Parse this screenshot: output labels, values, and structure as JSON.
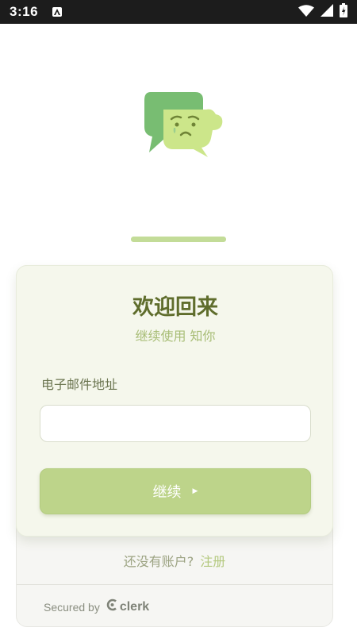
{
  "status_bar": {
    "time": "3:16",
    "icons": [
      "notification-a-icon",
      "wifi-icon",
      "signal-icon",
      "battery-icon"
    ]
  },
  "logo": {
    "icon": "sad-chat-bubble-logo",
    "colors": [
      "#78bd72",
      "#cce68a",
      "#7a8f3a"
    ]
  },
  "progress": {
    "value": 1.0,
    "color": "#c3dc98"
  },
  "sign_in": {
    "title": "欢迎回来",
    "subtitle": "继续使用 知你",
    "email_label": "电子邮件地址",
    "email_value": "",
    "continue_label": "继续",
    "continue_icon": "play-arrow-icon"
  },
  "footer": {
    "no_account_text": "还没有账户?",
    "signup_link": "注册",
    "secured_by": "Secured by",
    "clerk_brand": "clerk"
  },
  "colors": {
    "accent": "#bdd48a",
    "title": "#5f6d2c",
    "subtitle": "#a8bd76",
    "status_bar": "#1c1c1c"
  }
}
